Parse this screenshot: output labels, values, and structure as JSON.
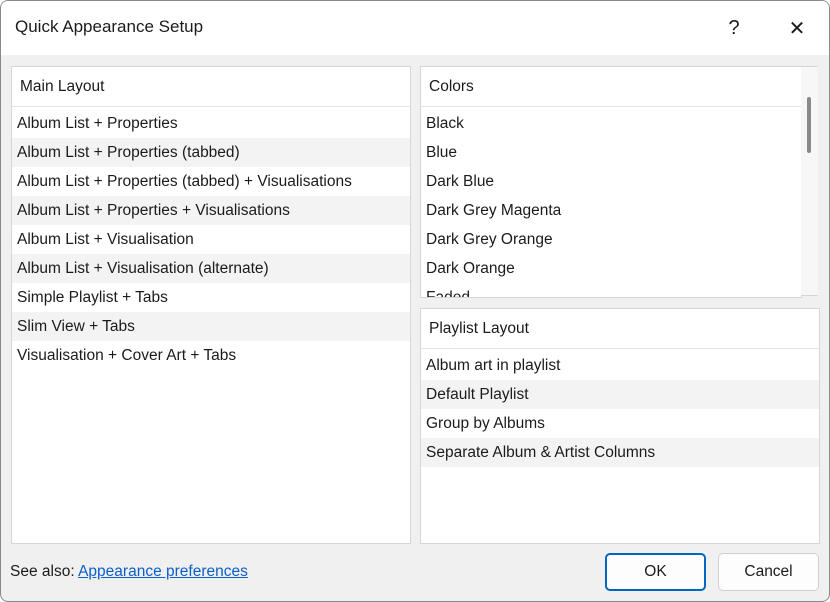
{
  "window": {
    "title": "Quick Appearance Setup",
    "help_glyph": "?",
    "close_glyph": "✕"
  },
  "main_layout": {
    "header": "Main Layout",
    "items": [
      "Album List + Properties",
      "Album List + Properties (tabbed)",
      "Album List + Properties (tabbed) + Visualisations",
      "Album List + Properties + Visualisations",
      "Album List + Visualisation",
      "Album List + Visualisation (alternate)",
      "Simple Playlist + Tabs",
      "Slim View + Tabs",
      "Visualisation + Cover Art + Tabs"
    ]
  },
  "colors": {
    "header": "Colors",
    "items": [
      "Black",
      "Blue",
      "Dark Blue",
      "Dark Grey Magenta",
      "Dark Grey Orange",
      "Dark Orange",
      "Faded"
    ]
  },
  "playlist_layout": {
    "header": "Playlist Layout",
    "items": [
      "Album art in playlist",
      "Default Playlist",
      "Group by Albums",
      "Separate Album & Artist Columns"
    ]
  },
  "footer": {
    "see_also_label": "See also:",
    "link_label": "Appearance preferences",
    "ok_label": "OK",
    "cancel_label": "Cancel"
  },
  "theme": {
    "accent": "#0067c0",
    "link": "#0a5fc8"
  }
}
